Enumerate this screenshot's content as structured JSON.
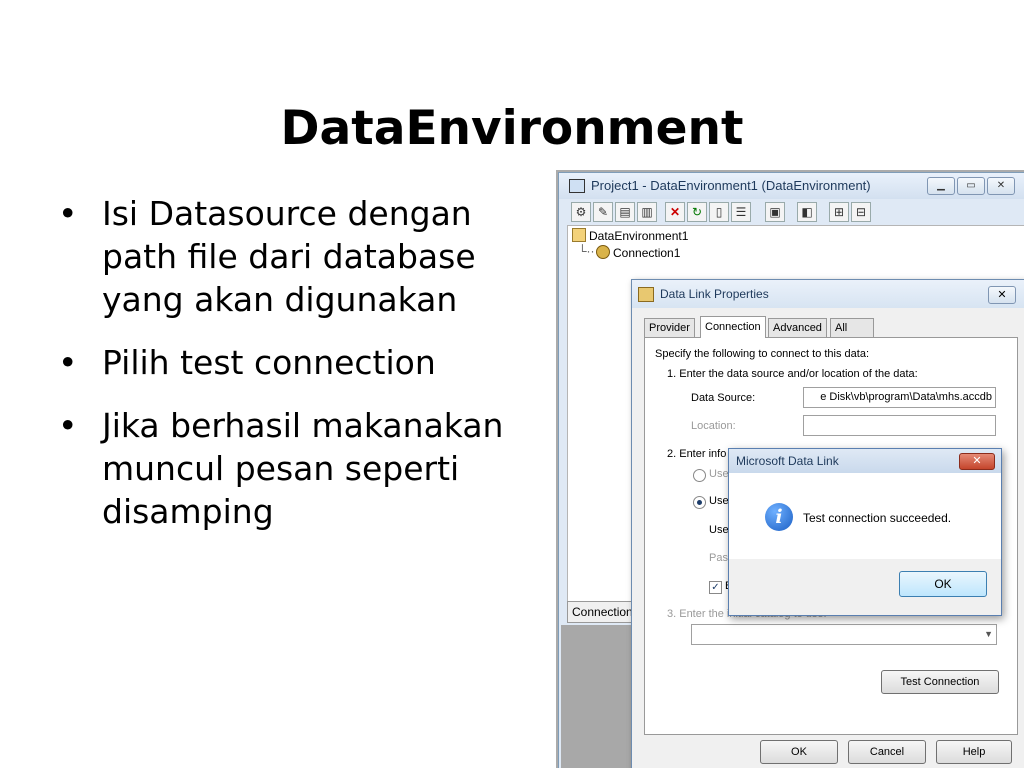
{
  "slide": {
    "title": "DataEnvironment",
    "bullets": [
      "Isi Datasource dengan path file dari database yang akan digunakan",
      "Pilih test connection",
      "Jika berhasil makanakan muncul pesan seperti disamping"
    ]
  },
  "ide_window": {
    "title": "Project1 - DataEnvironment1 (DataEnvironment)",
    "tree": {
      "root": "DataEnvironment1",
      "child": "Connection1"
    },
    "bottom_tab": "Connection"
  },
  "data_link_dialog": {
    "title": "Data Link Properties",
    "tabs": [
      "Provider",
      "Connection",
      "Advanced",
      "All"
    ],
    "active_tab": "Connection",
    "intro": "Specify the following to connect to this data:",
    "step1": "1. Enter the data source and/or location of the data:",
    "data_source_label": "Data Source:",
    "data_source_value": "e Disk\\vb\\program\\Data\\mhs.accdb",
    "location_label": "Location:",
    "location_value": "",
    "step2_partial": "2. Enter info",
    "radio1_partial": "Use",
    "radio2_partial": "Use",
    "user_partial": "Use",
    "pass_partial": "Pas",
    "check_partial": "B",
    "step3": "3. Enter the initial catalog to use:",
    "test_button": "Test Connection",
    "ok_button": "OK",
    "cancel_button": "Cancel",
    "help_button": "Help"
  },
  "message_box": {
    "title": "Microsoft Data Link",
    "close_glyph": "✕",
    "text": "Test connection succeeded.",
    "ok_button": "OK",
    "icon": "info-icon"
  }
}
